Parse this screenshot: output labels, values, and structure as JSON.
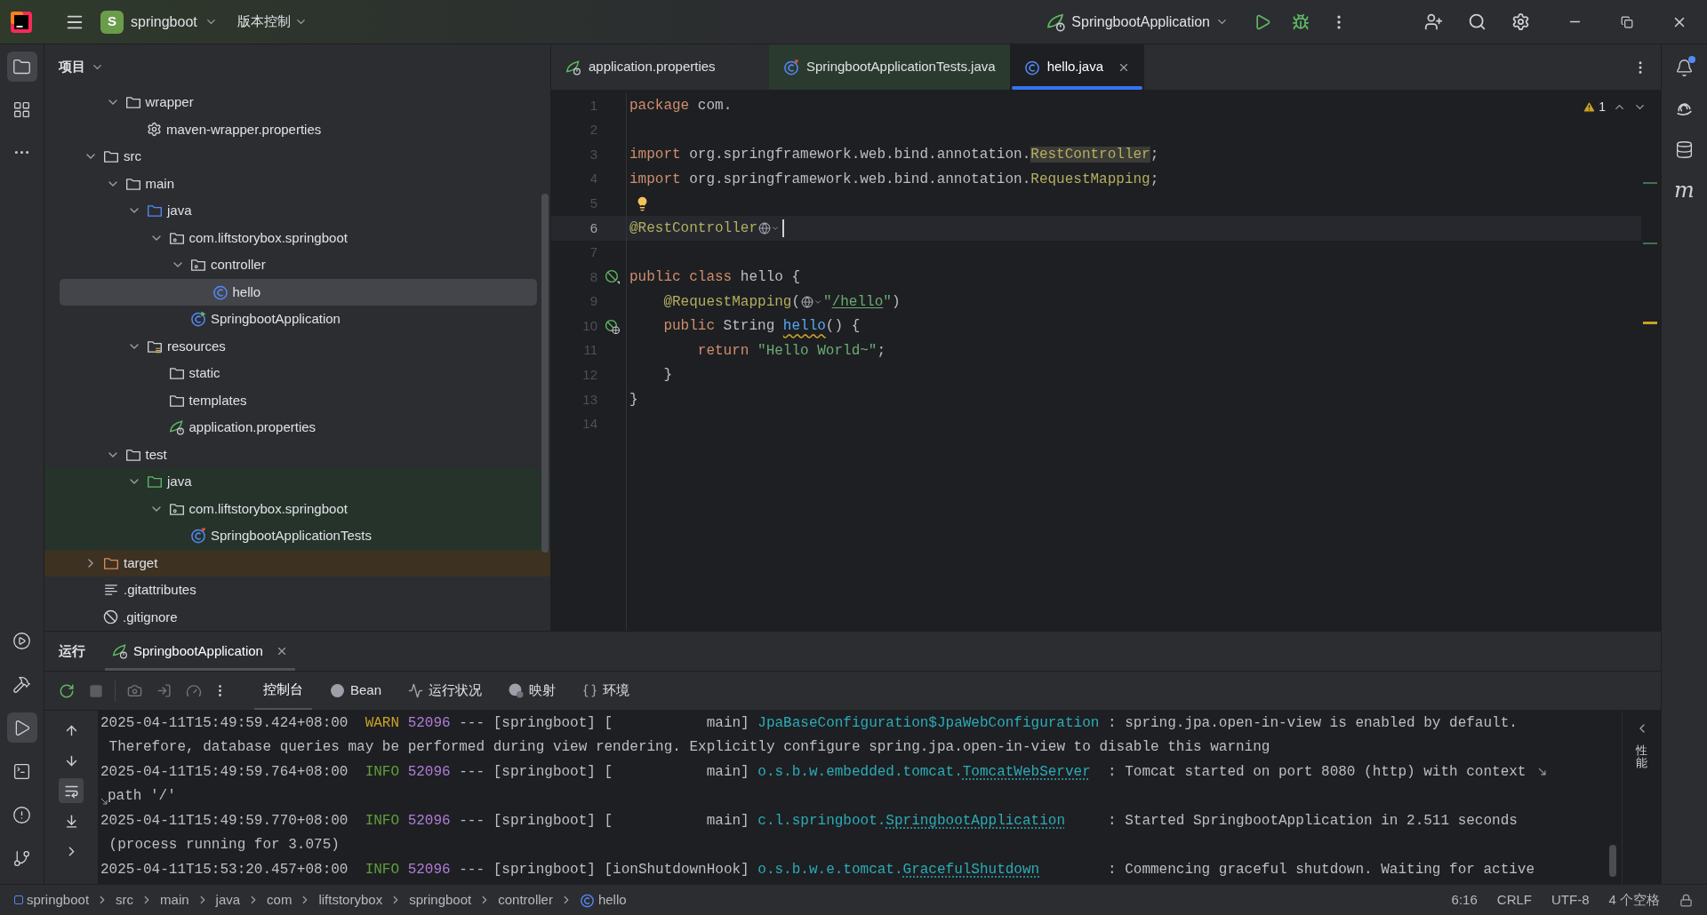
{
  "title_bar": {
    "project_letter": "S",
    "project": "springboot",
    "vcs": "版本控制",
    "run_config": "SpringbootApplication"
  },
  "tool_windows": {
    "top": [
      {
        "kind": "project",
        "selected": true
      },
      {
        "kind": "structure",
        "selected": false
      },
      {
        "kind": "more",
        "selected": false
      }
    ],
    "bottom": [
      {
        "kind": "services",
        "selected": false
      },
      {
        "kind": "build",
        "selected": false
      },
      {
        "kind": "run",
        "selected": true
      },
      {
        "kind": "terminal",
        "selected": false
      },
      {
        "kind": "problems",
        "selected": false
      },
      {
        "kind": "git",
        "selected": false
      }
    ]
  },
  "project_panel": {
    "title": "项目",
    "tree": [
      {
        "children": [
          {
            "label": "wrapper",
            "kind": "folder",
            "expanded": true,
            "selected": false,
            "children": [
              {
                "label": "maven-wrapper.properties",
                "kind": "settings",
                "selected": false
              }
            ]
          }
        ]
      },
      {
        "label": "src",
        "kind": "folder",
        "expanded": true,
        "selected": false,
        "children": [
          {
            "label": "main",
            "kind": "folder",
            "expanded": true,
            "selected": false,
            "children": [
              {
                "label": "java",
                "kind": "source",
                "expanded": true,
                "selected": false,
                "children": [
                  {
                    "label": "com.liftstorybox.springboot",
                    "kind": "package",
                    "expanded": true,
                    "selected": false,
                    "children": [
                      {
                        "label": "controller",
                        "kind": "package",
                        "expanded": true,
                        "selected": false,
                        "children": [
                          {
                            "label": "hello",
                            "kind": "class",
                            "selected": true
                          }
                        ]
                      },
                      {
                        "label": "SpringbootApplication",
                        "kind": "boot_class",
                        "selected": false
                      }
                    ]
                  }
                ]
              },
              {
                "label": "resources",
                "kind": "resources",
                "expanded": true,
                "selected": false,
                "children": [
                  {
                    "label": "static",
                    "kind": "folder",
                    "selected": false
                  },
                  {
                    "label": "templates",
                    "kind": "folder",
                    "selected": false
                  },
                  {
                    "label": "application.properties",
                    "kind": "spring_config",
                    "selected": false
                  }
                ]
              }
            ]
          },
          {
            "label": "test",
            "kind": "folder",
            "expanded": true,
            "selected": false,
            "children": [
              {
                "label": "java",
                "kind": "test_source",
                "test_scope": true,
                "expanded": true,
                "selected": false,
                "children": [
                  {
                    "label": "com.liftstorybox.springboot",
                    "kind": "package",
                    "test_scope": true,
                    "expanded": true,
                    "selected": false,
                    "children": [
                      {
                        "label": "SpringbootApplicationTests",
                        "kind": "test_class",
                        "test_scope": true,
                        "selected": false
                      }
                    ]
                  }
                ]
              }
            ]
          }
        ]
      },
      {
        "label": "target",
        "kind": "excluded",
        "excluded": true,
        "expanded": false,
        "selected": false
      },
      {
        "label": ".gitattributes",
        "kind": "text",
        "selected": false
      },
      {
        "label": ".gitignore",
        "kind": "ignore",
        "selected": false
      }
    ]
  },
  "editor": {
    "tabs": [
      {
        "label": "application.properties",
        "kind": "spring_config",
        "selected": false
      },
      {
        "label": "SpringbootApplicationTests.java",
        "kind": "test_class",
        "test_scope": true,
        "selected": false
      },
      {
        "label": "hello.java",
        "kind": "class",
        "selected": true,
        "closable": true
      }
    ],
    "warning_count": "1",
    "lines": [
      {
        "number": "1",
        "tokens": [
          {
            "text": "package",
            "kind": "keyword"
          },
          {
            "text": " com.",
            "kind": "plain"
          }
        ]
      },
      {
        "number": "2"
      },
      {
        "number": "3",
        "tokens": [
          {
            "text": "import",
            "kind": "keyword"
          },
          {
            "text": " org.springframework.web.bind.annotation.",
            "kind": "plain"
          },
          {
            "text": "RestController",
            "kind": "usage"
          },
          {
            "text": ";",
            "kind": "plain"
          }
        ]
      },
      {
        "number": "4",
        "tokens": [
          {
            "text": "import",
            "kind": "keyword"
          },
          {
            "text": " org.springframework.web.bind.annotation.",
            "kind": "plain"
          },
          {
            "text": "RequestMapping",
            "kind": "annotation"
          },
          {
            "text": ";",
            "kind": "plain"
          }
        ]
      },
      {
        "number": "5",
        "bulb": true
      },
      {
        "number": "6",
        "current": true,
        "caret": true,
        "tokens": [
          {
            "text": "@RestController",
            "kind": "annotation"
          },
          {
            "kind": "hint"
          }
        ]
      },
      {
        "number": "7"
      },
      {
        "number": "8",
        "kind": "bean",
        "tokens": [
          {
            "text": "public class",
            "kind": "keyword"
          },
          {
            "text": " hello {",
            "kind": "plain"
          }
        ]
      },
      {
        "number": "9",
        "tokens": [
          {
            "text": "    @RequestMapping",
            "kind": "annotation"
          },
          {
            "text": "(",
            "kind": "plain"
          },
          {
            "kind": "hint"
          },
          {
            "text": "\"",
            "kind": "string"
          },
          {
            "text": "/hello",
            "kind": "link"
          },
          {
            "text": "\"",
            "kind": "string"
          },
          {
            "text": ")",
            "kind": "plain"
          }
        ]
      },
      {
        "number": "10",
        "kind": "endpoint",
        "tokens": [
          {
            "text": "    public",
            "kind": "keyword"
          },
          {
            "text": " String ",
            "kind": "plain"
          },
          {
            "text": "hello",
            "kind": "method"
          },
          {
            "text": "() {",
            "kind": "plain"
          }
        ]
      },
      {
        "number": "11",
        "tokens": [
          {
            "text": "        return ",
            "kind": "keyword"
          },
          {
            "text": "\"Hello World~\"",
            "kind": "string"
          },
          {
            "text": ";",
            "kind": "plain"
          }
        ]
      },
      {
        "number": "12",
        "tokens": [
          {
            "text": "    }",
            "kind": "plain"
          }
        ]
      },
      {
        "number": "13",
        "tokens": [
          {
            "text": "}",
            "kind": "plain"
          }
        ]
      },
      {
        "number": "14"
      }
    ]
  },
  "run_panel": {
    "title": "运行",
    "tabs": [
      {
        "label": "SpringbootApplication",
        "selected": true
      }
    ],
    "views": [
      {
        "label": "控制台",
        "kind": "console",
        "selected": true
      },
      {
        "label": "Bean",
        "kind": "beans",
        "selected": false
      },
      {
        "label": "运行状况",
        "kind": "health",
        "selected": false
      },
      {
        "label": "映射",
        "kind": "mappings",
        "selected": false
      },
      {
        "label": "环境",
        "kind": "environment",
        "selected": false
      }
    ],
    "console_tools": [
      {
        "kind": "up",
        "selected": false
      },
      {
        "kind": "down",
        "selected": false
      },
      {
        "kind": "soft_wrap",
        "selected": true
      },
      {
        "kind": "scroll_end",
        "selected": false
      },
      {
        "kind": "expand",
        "selected": false
      }
    ],
    "console": [
      {
        "kind": "log",
        "time": "2025-04-11T15:49:59.424+08:00",
        "level": "WARN",
        "pid": "52096",
        "context": "--- [springboot]",
        "thread": "[           main]",
        "logger": [
          {
            "text": "JpaBaseConfiguration$JpaWebConfiguration",
            "link": false
          }
        ],
        "message": ": spring.jpa.open-in-view is enabled by default."
      },
      {
        "kind": "continuation",
        "text": " Therefore, database queries may be performed during view rendering. Explicitly configure spring.jpa.open-in-view to disable this warning"
      },
      {
        "kind": "log",
        "time": "2025-04-11T15:49:59.764+08:00",
        "level": "INFO",
        "pid": "52096",
        "context": "--- [springboot]",
        "thread": "[           main]",
        "logger": [
          {
            "text": "o.s.b.w.embedded.tomcat.",
            "link": false
          },
          {
            "text": "TomcatWebServer",
            "link": true
          }
        ],
        "message": ": Tomcat started on port 8080 (http) with context",
        "wrap_mark": true
      },
      {
        "kind": "continuation",
        "text": "path '/'",
        "wrap_mark": true
      },
      {
        "kind": "log",
        "time": "2025-04-11T15:49:59.770+08:00",
        "level": "INFO",
        "pid": "52096",
        "context": "--- [springboot]",
        "thread": "[           main]",
        "logger": [
          {
            "text": "c.l.springboot.",
            "link": false
          },
          {
            "text": "SpringbootApplication",
            "link": true
          }
        ],
        "message": ": Started SpringbootApplication in 2.511 seconds"
      },
      {
        "kind": "continuation",
        "text": " (process running for 3.075)"
      },
      {
        "kind": "log",
        "time": "2025-04-11T15:53:20.457+08:00",
        "level": "INFO",
        "pid": "52096",
        "context": "--- [springboot]",
        "thread": "[ionShutdownHook]",
        "logger": [
          {
            "text": "o.s.b.w.e.tomcat.",
            "link": false
          },
          {
            "text": "GracefulShutdown",
            "link": true
          }
        ],
        "message": ": Commencing graceful shutdown. Waiting for active"
      }
    ],
    "side_label": "性能"
  },
  "right_toolbar": [
    {
      "kind": "notifications",
      "badge": true
    },
    {
      "kind": "ai"
    },
    {
      "kind": "database"
    },
    {
      "kind": "maven",
      "glyph": "m"
    }
  ],
  "breadcrumbs": [
    {
      "label": "springboot",
      "kind": "module"
    },
    {
      "label": "src"
    },
    {
      "label": "main"
    },
    {
      "label": "java"
    },
    {
      "label": "com"
    },
    {
      "label": "liftstorybox"
    },
    {
      "label": "springboot"
    },
    {
      "label": "controller"
    },
    {
      "label": "hello",
      "kind": "class"
    }
  ],
  "status_bar": [
    "6:16",
    "CRLF",
    "UTF-8",
    "4 个空格"
  ]
}
